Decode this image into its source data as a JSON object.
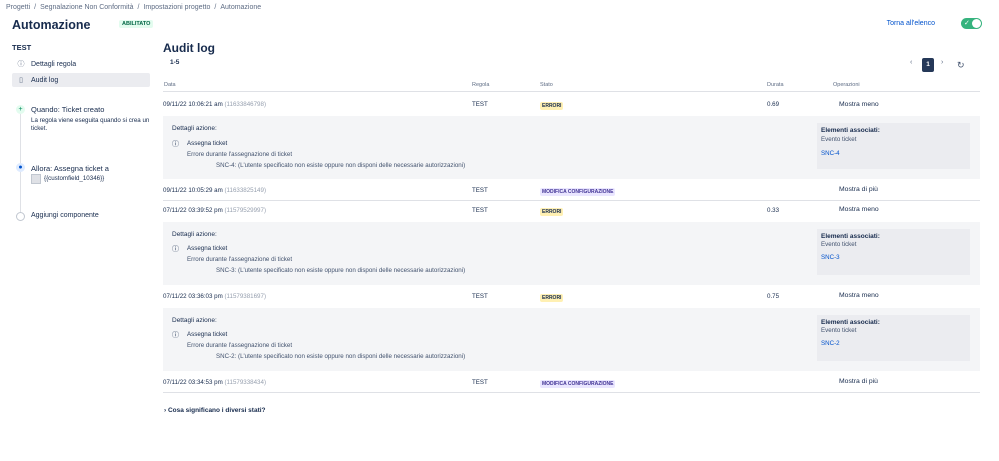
{
  "breadcrumb": [
    "Progetti",
    "Segnalazione Non Conformità",
    "Impostazioni progetto",
    "Automazione"
  ],
  "breadcrumb_sep": "/",
  "header": {
    "title": "Automazione",
    "status_badge": "ABILITATO",
    "back_link": "Torna all'elenco",
    "toggle_on": true
  },
  "sidebar": {
    "rule_name": "TEST",
    "items": [
      {
        "label": "Dettagli regola",
        "icon": "info-icon"
      },
      {
        "label": "Audit log",
        "icon": "document-icon"
      }
    ],
    "flow": {
      "trigger_title": "Quando: Ticket creato",
      "trigger_desc": "La regola viene eseguita quando si crea un ticket.",
      "action_title": "Allora: Assegna ticket a",
      "action_field": "{{customfield_10346}}",
      "add_component": "Aggiungi componente"
    }
  },
  "main": {
    "title": "Audit log",
    "count": "1-5",
    "pagination": {
      "prev": "‹",
      "page": "1",
      "next": "›"
    },
    "columns": [
      "Data",
      "Regola",
      "Stato",
      "Durata",
      "Operazioni"
    ],
    "rows": [
      {
        "date": "09/11/22 10:06:21 am",
        "id": "(11633846798)",
        "rule": "TEST",
        "status": "ERRORI",
        "duration": "0.69",
        "op": "Mostra meno"
      },
      {
        "date": "09/11/22 10:05:29 am",
        "id": "(11633825149)",
        "rule": "TEST",
        "status": "MODIFICA CONFIGURAZIONE",
        "duration": "",
        "op": "Mostra di più"
      },
      {
        "date": "07/11/22 03:39:52 pm",
        "id": "(11579529997)",
        "rule": "TEST",
        "status": "ERRORI",
        "duration": "0.33",
        "op": "Mostra meno"
      },
      {
        "date": "07/11/22 03:36:03 pm",
        "id": "(11579381697)",
        "rule": "TEST",
        "status": "ERRORI",
        "duration": "0.75",
        "op": "Mostra meno"
      },
      {
        "date": "07/11/22 03:34:53 pm",
        "id": "(11579338434)",
        "rule": "TEST",
        "status": "MODIFICA CONFIGURAZIONE",
        "duration": "",
        "op": "Mostra di più"
      }
    ],
    "details": [
      {
        "heading": "Dettagli azione:",
        "action": "Assegna ticket",
        "error": "Errore durante l'assegnazione di ticket",
        "message": "SNC-4: (L'utente specificato non esiste oppure non disponi delle necessarie autorizzazioni)",
        "assoc_title": "Elementi associati:",
        "assoc_sub": "Evento ticket",
        "assoc_link": "SNC-4"
      },
      {
        "heading": "Dettagli azione:",
        "action": "Assegna ticket",
        "error": "Errore durante l'assegnazione di ticket",
        "message": "SNC-3: (L'utente specificato non esiste oppure non disponi delle necessarie autorizzazioni)",
        "assoc_title": "Elementi associati:",
        "assoc_sub": "Evento ticket",
        "assoc_link": "SNC-3"
      },
      {
        "heading": "Dettagli azione:",
        "action": "Assegna ticket",
        "error": "Errore durante l'assegnazione di ticket",
        "message": "SNC-2: (L'utente specificato non esiste oppure non disponi delle necessarie autorizzazioni)",
        "assoc_title": "Elementi associati:",
        "assoc_sub": "Evento ticket",
        "assoc_link": "SNC-2"
      }
    ],
    "footer_link": "Cosa significano i diversi stati?"
  },
  "colors": {
    "accent": "#0052cc",
    "toggle": "#36b37e",
    "error_lozenge": "#fff0b3",
    "config_lozenge": "#eae6ff"
  }
}
